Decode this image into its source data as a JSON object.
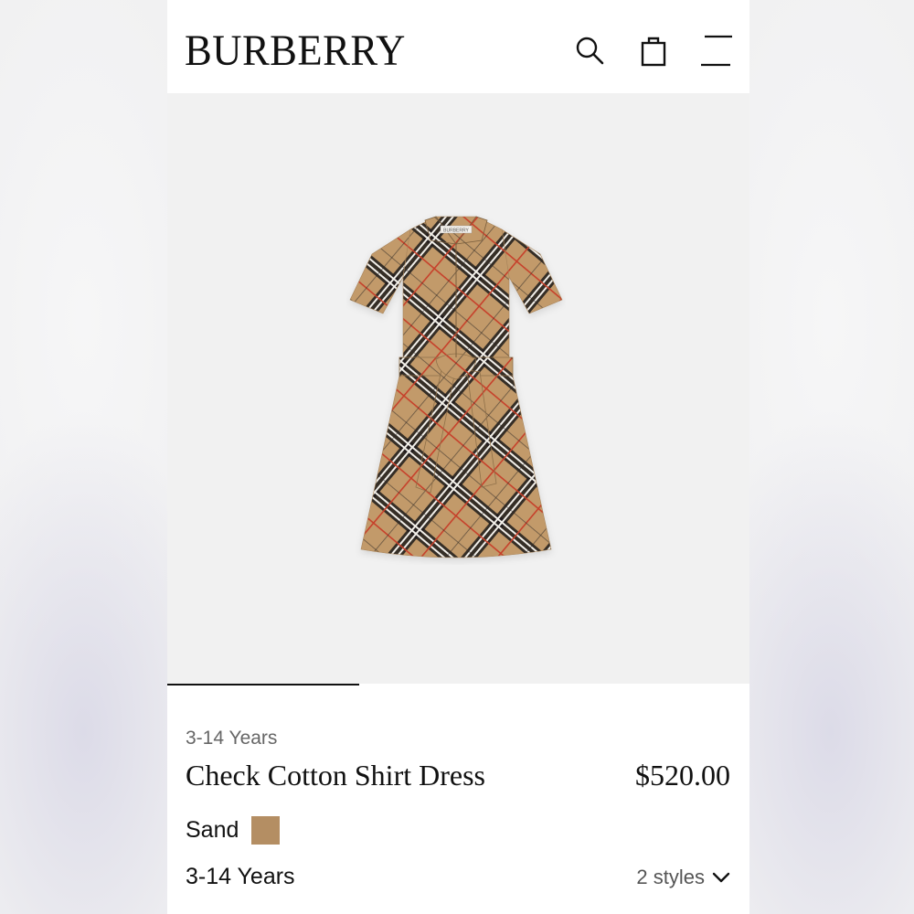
{
  "header": {
    "brand": "BURBERRY",
    "icons": [
      "search-icon",
      "bag-icon",
      "menu-icon"
    ]
  },
  "gallery": {
    "image_subject": "dress-image",
    "label_text": "BURBERRY",
    "progress": 0.33
  },
  "product": {
    "age_range_small": "3-14 Years",
    "title": "Check Cotton Shirt Dress",
    "price": "$520.00",
    "color": {
      "name": "Sand",
      "swatch": "#b48e63"
    },
    "size_range": "3-14 Years",
    "styles_label": "2 styles"
  },
  "colors": {
    "accent": "#111111",
    "check_base": "#c29a6a",
    "check_dark": "#1d1b1c",
    "check_red": "#c6412b"
  }
}
